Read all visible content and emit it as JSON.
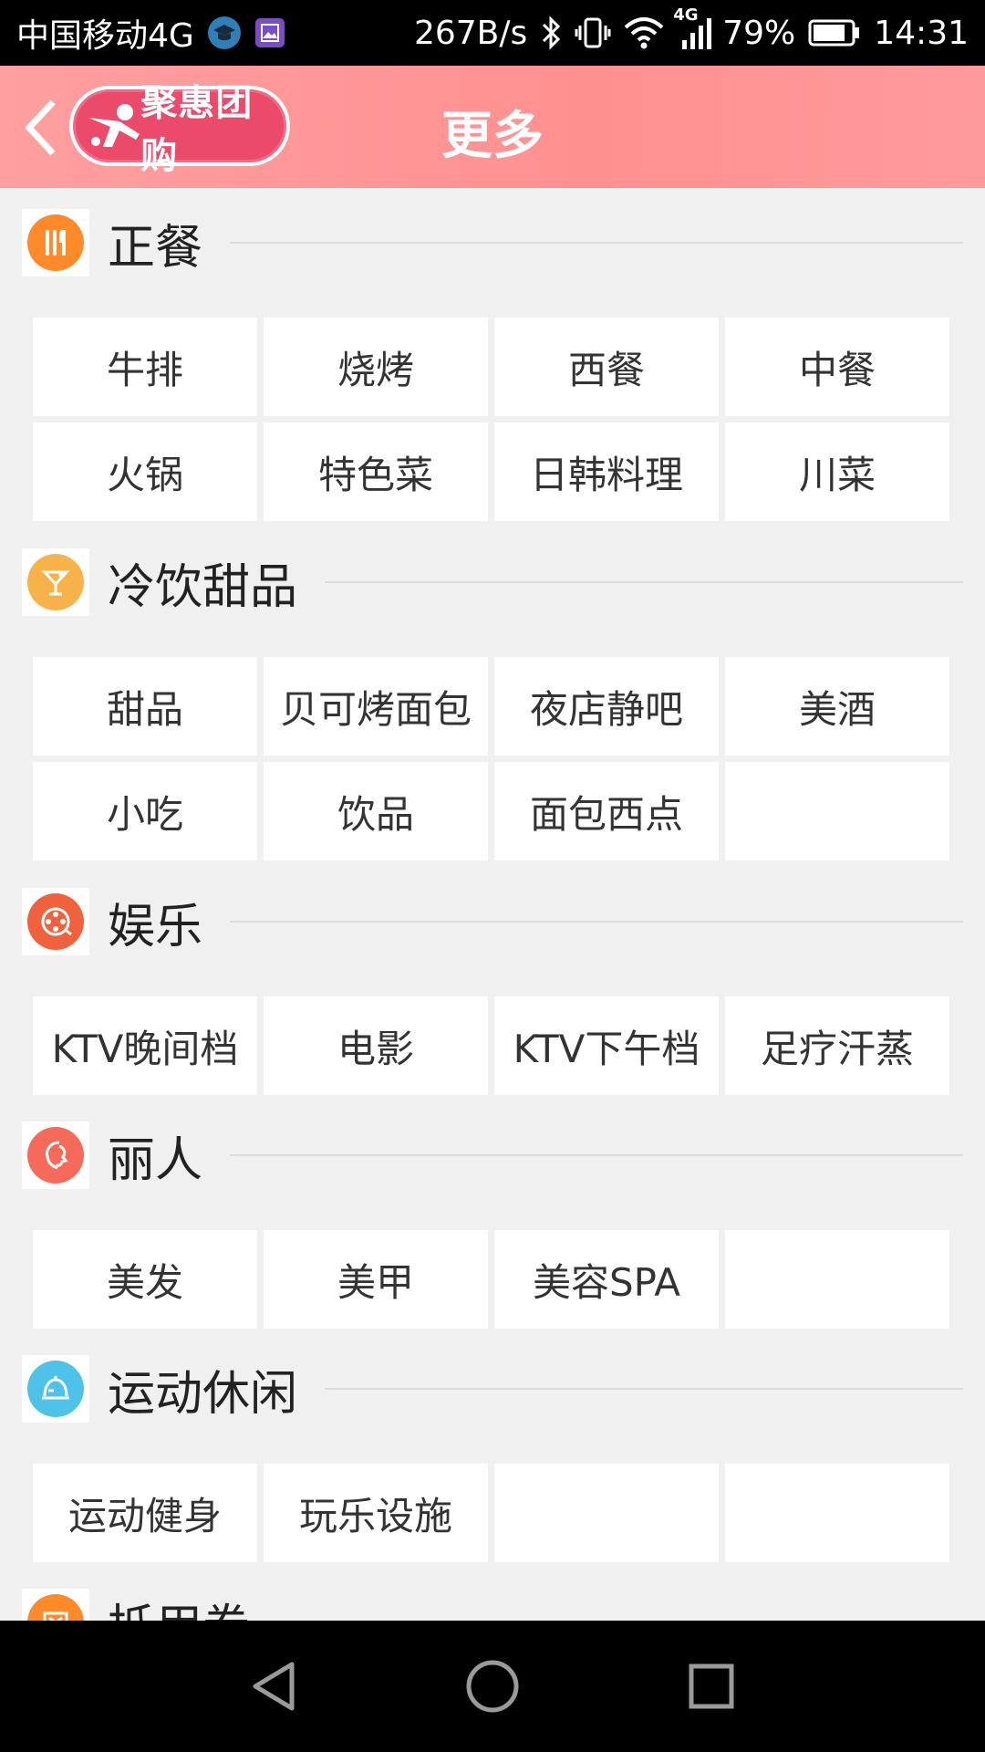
{
  "status_bar": {
    "carrier": "中国移动4G",
    "speed": "267B/s",
    "battery": "79%",
    "time": "14:31",
    "network": "4G"
  },
  "header": {
    "title": "更多",
    "logo_text": "聚惠团购"
  },
  "colors": {
    "header_bg": "#ff9a9b",
    "icon_dining": "#ff8a2a",
    "icon_drinks": "#f7b24a",
    "icon_entertainment": "#f0623e",
    "icon_beauty": "#f66a5a",
    "icon_sports": "#4ec2e8",
    "icon_coupon": "#ff8a2a"
  },
  "sections": [
    {
      "title": "正餐",
      "icon": "utensils-icon",
      "items": [
        "牛排",
        "烧烤",
        "西餐",
        "中餐",
        "火锅",
        "特色菜",
        "日韩料理",
        "川菜"
      ]
    },
    {
      "title": "冷饮甜品",
      "icon": "cocktail-icon",
      "items": [
        "甜品",
        "贝可烤面包",
        "夜店静吧",
        "美酒",
        "小吃",
        "饮品",
        "面包西点",
        ""
      ]
    },
    {
      "title": "娱乐",
      "icon": "film-reel-icon",
      "items": [
        "KTV晚间档",
        "电影",
        "KTV下午档",
        "足疗汗蒸"
      ]
    },
    {
      "title": "丽人",
      "icon": "woman-profile-icon",
      "items": [
        "美发",
        "美甲",
        "美容SPA",
        ""
      ]
    },
    {
      "title": "运动休闲",
      "icon": "dome-icon",
      "items": [
        "运动健身",
        "玩乐设施",
        "",
        ""
      ]
    },
    {
      "title": "抵用券",
      "icon": "coupon-icon",
      "items": []
    }
  ],
  "nav": {
    "back": "back-triangle-icon",
    "home": "home-circle-icon",
    "recent": "recent-square-icon"
  }
}
